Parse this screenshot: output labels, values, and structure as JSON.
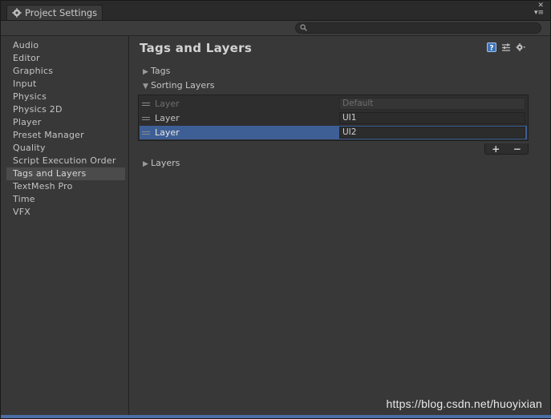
{
  "window": {
    "tab_title": "Project Settings",
    "search": {
      "value": "",
      "placeholder": ""
    }
  },
  "sidebar": {
    "items": [
      {
        "label": "Audio"
      },
      {
        "label": "Editor"
      },
      {
        "label": "Graphics"
      },
      {
        "label": "Input"
      },
      {
        "label": "Physics"
      },
      {
        "label": "Physics 2D"
      },
      {
        "label": "Player"
      },
      {
        "label": "Preset Manager"
      },
      {
        "label": "Quality"
      },
      {
        "label": "Script Execution Order"
      },
      {
        "label": "Tags and Layers",
        "selected": true
      },
      {
        "label": "TextMesh Pro"
      },
      {
        "label": "Time"
      },
      {
        "label": "VFX"
      }
    ]
  },
  "main": {
    "title": "Tags and Layers",
    "icons": [
      "help-icon",
      "preset-icon",
      "settings-gear-icon"
    ],
    "sections": {
      "tags": {
        "label": "Tags",
        "expanded": false
      },
      "sorting_layers": {
        "label": "Sorting Layers",
        "expanded": true
      },
      "layers": {
        "label": "Layers",
        "expanded": false
      }
    },
    "sorting_rows": [
      {
        "label": "Layer",
        "value": "Default",
        "state": "disabled"
      },
      {
        "label": "Layer",
        "value": "UI1",
        "state": "normal"
      },
      {
        "label": "Layer",
        "value": "UI2",
        "state": "selected"
      }
    ],
    "add_label": "+",
    "remove_label": "−"
  },
  "watermark": "https://blog.csdn.net/huoyixian",
  "colors": {
    "selection": "#3e5f96",
    "panel": "#383838",
    "text": "#c4c4c4"
  }
}
